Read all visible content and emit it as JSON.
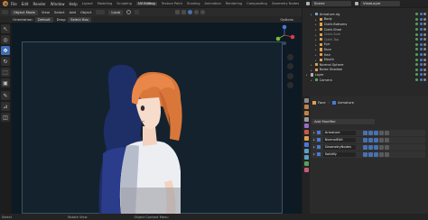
{
  "menus": [
    "File",
    "Edit",
    "Render",
    "Window",
    "Help"
  ],
  "workspaces": [
    "Layout",
    "Modeling",
    "Sculpting",
    "UV Editing",
    "Texture Paint",
    "Shading",
    "Animation",
    "Rendering",
    "Compositing",
    "Geometry Nodes"
  ],
  "active_workspace": "UV Editing",
  "scene_name": "Scene",
  "view_layer": "ViewLayer",
  "viewport_header": {
    "mode": "Object Mode",
    "view": "View",
    "select": "Select",
    "add": "Add",
    "object": "Object",
    "transform": "Local",
    "options": "Options"
  },
  "tool_header": {
    "orientation_label": "Orientation:",
    "orientation": "Default",
    "drag_label": "Drag:",
    "drag": "Select Box"
  },
  "outliner": {
    "rows": [
      {
        "name": "Armature.rig",
        "indent": 1,
        "color": "#7fa0c8",
        "dim": false
      },
      {
        "name": "Body",
        "indent": 2,
        "color": "#e0a050",
        "dim": false
      },
      {
        "name": "Cloth.Bottoms",
        "indent": 2,
        "color": "#e0a050",
        "dim": false
      },
      {
        "name": "Cloth.Shoe",
        "indent": 2,
        "color": "#e0a050",
        "dim": false
      },
      {
        "name": "Cloth.Sole",
        "indent": 2,
        "color": "#e0a050",
        "dim": true
      },
      {
        "name": "Cloth.Top",
        "indent": 2,
        "color": "#e0a050",
        "dim": true
      },
      {
        "name": "Eye",
        "indent": 2,
        "color": "#e0a050",
        "dim": false
      },
      {
        "name": "Face",
        "indent": 2,
        "color": "#e0a050",
        "dim": false
      },
      {
        "name": "Hair",
        "indent": 2,
        "color": "#e0a050",
        "dim": false
      },
      {
        "name": "Mouth",
        "indent": 2,
        "color": "#e0a050",
        "dim": false
      },
      {
        "name": "Normal Sphere",
        "indent": 1,
        "color": "#e0a050",
        "dim": false
      },
      {
        "name": "Noise Shadow",
        "indent": 1,
        "color": "#e0a050",
        "dim": false
      },
      {
        "name": "Layer",
        "indent": 0,
        "color": "#b0b0b0",
        "dim": false
      },
      {
        "name": "Camera",
        "indent": 1,
        "color": "#5aa05a",
        "dim": false
      }
    ]
  },
  "properties": {
    "breadcrumb_object": "Face",
    "breadcrumb_modifier": "Armature",
    "add_modifier": "Add Modifier",
    "modifiers": [
      "Armature",
      "NormalEdit",
      "GeometryNodes",
      "Solidify"
    ]
  },
  "statusbar": {
    "select": "Select",
    "rotate": "Rotate View",
    "context": "Object Context Menu"
  },
  "colors": {
    "accent": "#4772b3",
    "hair": "#d9773a",
    "viewport_bg": "#0d1a23"
  }
}
